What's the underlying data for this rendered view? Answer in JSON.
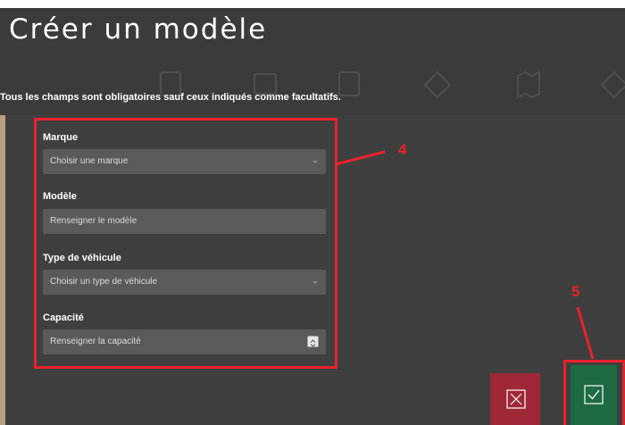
{
  "header": {
    "title": "Créer un modèle",
    "subtitle": "Tous les champs sont obligatoires sauf ceux indiqués comme facultatifs."
  },
  "form": {
    "marque": {
      "label": "Marque",
      "placeholder": "Choisir une marque"
    },
    "modele": {
      "label": "Modèle",
      "placeholder": "Renseigner le modèle"
    },
    "type_vehicule": {
      "label": "Type de véhicule",
      "placeholder": "Choisir un type de véhicule"
    },
    "capacite": {
      "label": "Capacité",
      "placeholder": "Renseigner la capacité"
    }
  },
  "callouts": {
    "form": "4",
    "confirm": "5"
  },
  "buttons": {
    "cancel_icon": "close-icon",
    "confirm_icon": "check-icon"
  },
  "colors": {
    "background": "#3f3f3f",
    "field": "#5a5a5a",
    "annotation": "#e8222c",
    "cancel": "#9e2836",
    "confirm": "#1e6a42"
  }
}
